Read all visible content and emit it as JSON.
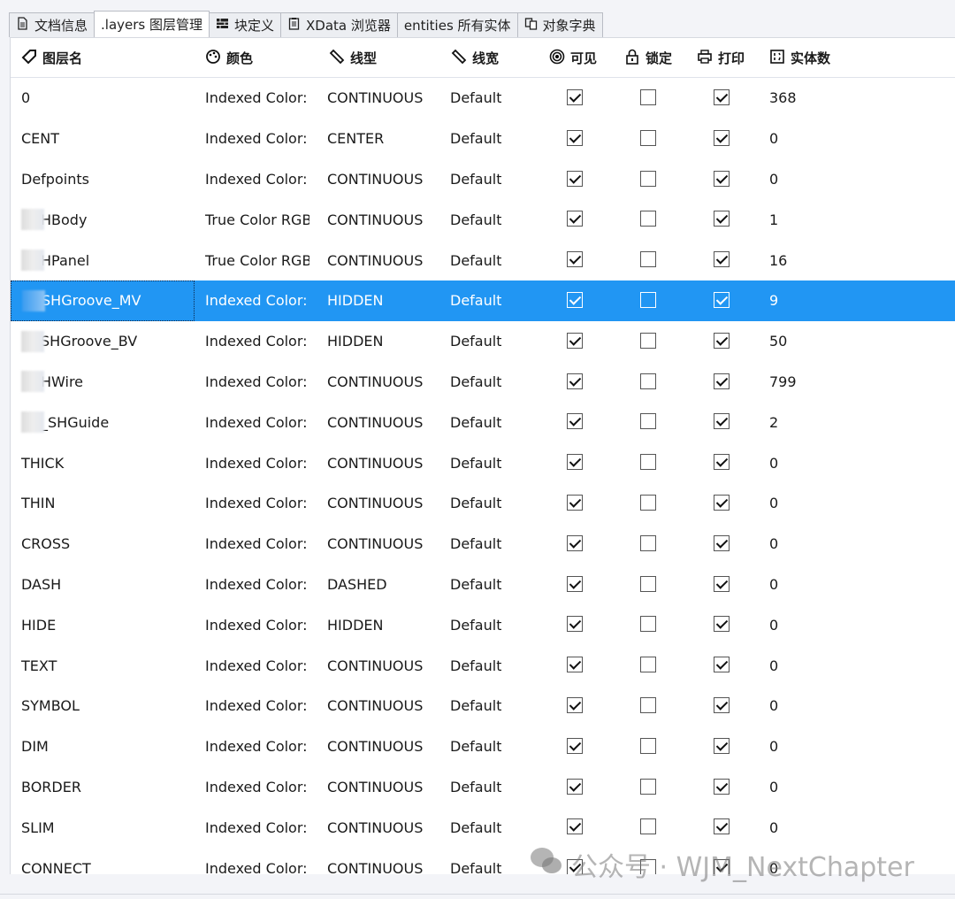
{
  "tabs": [
    {
      "label": "文档信息",
      "icon": "document-icon"
    },
    {
      "label": ".layers 图层管理",
      "icon": null,
      "active": true
    },
    {
      "label": "块定义",
      "icon": "block-icon"
    },
    {
      "label": "XData 浏览器",
      "icon": "clipboard-icon"
    },
    {
      "label": "entities 所有实体",
      "icon": null
    },
    {
      "label": "对象字典",
      "icon": "copy-icon"
    }
  ],
  "columns": {
    "name": "图层名",
    "color": "颜色",
    "linetype": "线型",
    "lineweight": "线宽",
    "visible": "可见",
    "locked": "锁定",
    "print": "打印",
    "count": "实体数"
  },
  "rows": [
    {
      "name": "0",
      "color": "Indexed Color:",
      "lt": "CONTINUOUS",
      "lw": "Default",
      "v": true,
      "l": false,
      "p": true,
      "n": "368"
    },
    {
      "name": "CENT",
      "color": "Indexed Color:",
      "lt": "CENTER",
      "lw": "Default",
      "v": true,
      "l": false,
      "p": true,
      "n": "0"
    },
    {
      "name": "Defpoints",
      "color": "Indexed Color:",
      "lt": "CONTINUOUS",
      "lw": "Default",
      "v": true,
      "l": false,
      "p": true,
      "n": "0"
    },
    {
      "name": "HBody",
      "blur": true,
      "color": "True Color RGB",
      "lt": "CONTINUOUS",
      "lw": "Default",
      "v": true,
      "l": false,
      "p": true,
      "n": "1"
    },
    {
      "name": "HPanel",
      "blur": true,
      "color": "True Color RGB",
      "lt": "CONTINUOUS",
      "lw": "Default",
      "v": true,
      "l": false,
      "p": true,
      "n": "16"
    },
    {
      "name": "SHGroove_MV",
      "blur": true,
      "color": "Indexed Color:",
      "lt": "HIDDEN",
      "lw": "Default",
      "v": true,
      "l": false,
      "p": true,
      "n": "9",
      "selected": true
    },
    {
      "name": "SHGroove_BV",
      "blur": true,
      "color": "Indexed Color:",
      "lt": "HIDDEN",
      "lw": "Default",
      "v": true,
      "l": false,
      "p": true,
      "n": "50"
    },
    {
      "name": "HWire",
      "blur": true,
      "color": "Indexed Color:",
      "lt": "CONTINUOUS",
      "lw": "Default",
      "v": true,
      "l": false,
      "p": true,
      "n": "799"
    },
    {
      "name": "_SHGuide",
      "blur": true,
      "color": "Indexed Color:",
      "lt": "CONTINUOUS",
      "lw": "Default",
      "v": true,
      "l": false,
      "p": true,
      "n": "2"
    },
    {
      "name": "THICK",
      "color": "Indexed Color:",
      "lt": "CONTINUOUS",
      "lw": "Default",
      "v": true,
      "l": false,
      "p": true,
      "n": "0"
    },
    {
      "name": "THIN",
      "color": "Indexed Color:",
      "lt": "CONTINUOUS",
      "lw": "Default",
      "v": true,
      "l": false,
      "p": true,
      "n": "0"
    },
    {
      "name": "CROSS",
      "color": "Indexed Color:",
      "lt": "CONTINUOUS",
      "lw": "Default",
      "v": true,
      "l": false,
      "p": true,
      "n": "0"
    },
    {
      "name": "DASH",
      "color": "Indexed Color:",
      "lt": "DASHED",
      "lw": "Default",
      "v": true,
      "l": false,
      "p": true,
      "n": "0"
    },
    {
      "name": "HIDE",
      "color": "Indexed Color:",
      "lt": "HIDDEN",
      "lw": "Default",
      "v": true,
      "l": false,
      "p": true,
      "n": "0"
    },
    {
      "name": "TEXT",
      "color": "Indexed Color:",
      "lt": "CONTINUOUS",
      "lw": "Default",
      "v": true,
      "l": false,
      "p": true,
      "n": "0"
    },
    {
      "name": "SYMBOL",
      "color": "Indexed Color:",
      "lt": "CONTINUOUS",
      "lw": "Default",
      "v": true,
      "l": false,
      "p": true,
      "n": "0"
    },
    {
      "name": "DIM",
      "color": "Indexed Color:",
      "lt": "CONTINUOUS",
      "lw": "Default",
      "v": true,
      "l": false,
      "p": true,
      "n": "0"
    },
    {
      "name": "BORDER",
      "color": "Indexed Color:",
      "lt": "CONTINUOUS",
      "lw": "Default",
      "v": true,
      "l": false,
      "p": true,
      "n": "0"
    },
    {
      "name": "SLIM",
      "color": "Indexed Color:",
      "lt": "CONTINUOUS",
      "lw": "Default",
      "v": true,
      "l": false,
      "p": true,
      "n": "0"
    },
    {
      "name": "CONNECT",
      "color": "Indexed Color:",
      "lt": "CONTINUOUS",
      "lw": "Default",
      "v": true,
      "l": false,
      "p": true,
      "n": "0"
    }
  ],
  "watermark": "公众号 · WJM_NextChapter",
  "colors": {
    "selection": "#2196f3"
  }
}
